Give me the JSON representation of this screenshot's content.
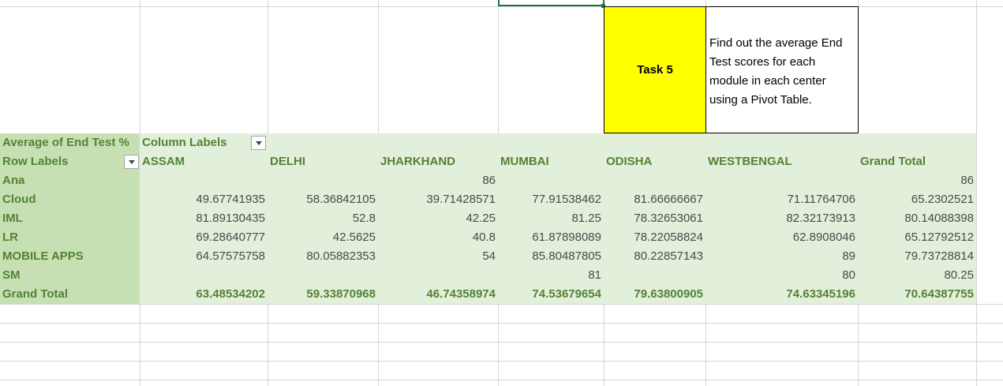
{
  "task": {
    "label": "Task 5",
    "description": "Find out the average End Test scores for each module in each center using a Pivot Table."
  },
  "pivot": {
    "value_field": "Average of End Test %",
    "column_labels": "Column Labels",
    "row_labels": "Row Labels",
    "columns": [
      "ASSAM",
      "DELHI",
      "JHARKHAND",
      "MUMBAI",
      "ODISHA",
      "WESTBENGAL",
      "Grand Total"
    ],
    "rows": [
      {
        "label": "Ana",
        "values": [
          "",
          "",
          "86",
          "",
          "",
          "",
          "86"
        ]
      },
      {
        "label": "Cloud",
        "values": [
          "49.67741935",
          "58.36842105",
          "39.71428571",
          "77.91538462",
          "81.66666667",
          "71.11764706",
          "65.2302521"
        ]
      },
      {
        "label": "IML",
        "values": [
          "81.89130435",
          "52.8",
          "42.25",
          "81.25",
          "78.32653061",
          "82.32173913",
          "80.14088398"
        ]
      },
      {
        "label": "LR",
        "values": [
          "69.28640777",
          "42.5625",
          "40.8",
          "61.87898089",
          "78.22058824",
          "62.8908046",
          "65.12792512"
        ]
      },
      {
        "label": "MOBILE APPS",
        "values": [
          "64.57575758",
          "80.05882353",
          "54",
          "85.80487805",
          "80.22857143",
          "89",
          "79.73728814"
        ]
      },
      {
        "label": "SM",
        "values": [
          "",
          "",
          "",
          "81",
          "",
          "80",
          "80.25"
        ]
      }
    ],
    "grand_total": {
      "label": "Grand Total",
      "values": [
        "63.48534202",
        "59.33870968",
        "46.74358974",
        "74.53679654",
        "79.63800905",
        "74.63345196",
        "70.64387755"
      ]
    }
  },
  "colors": {
    "pivot_light": "#e2efda",
    "pivot_dark": "#c6e0b4",
    "header_text": "#548235",
    "task_fill": "#ffff00",
    "selection": "#217346"
  }
}
